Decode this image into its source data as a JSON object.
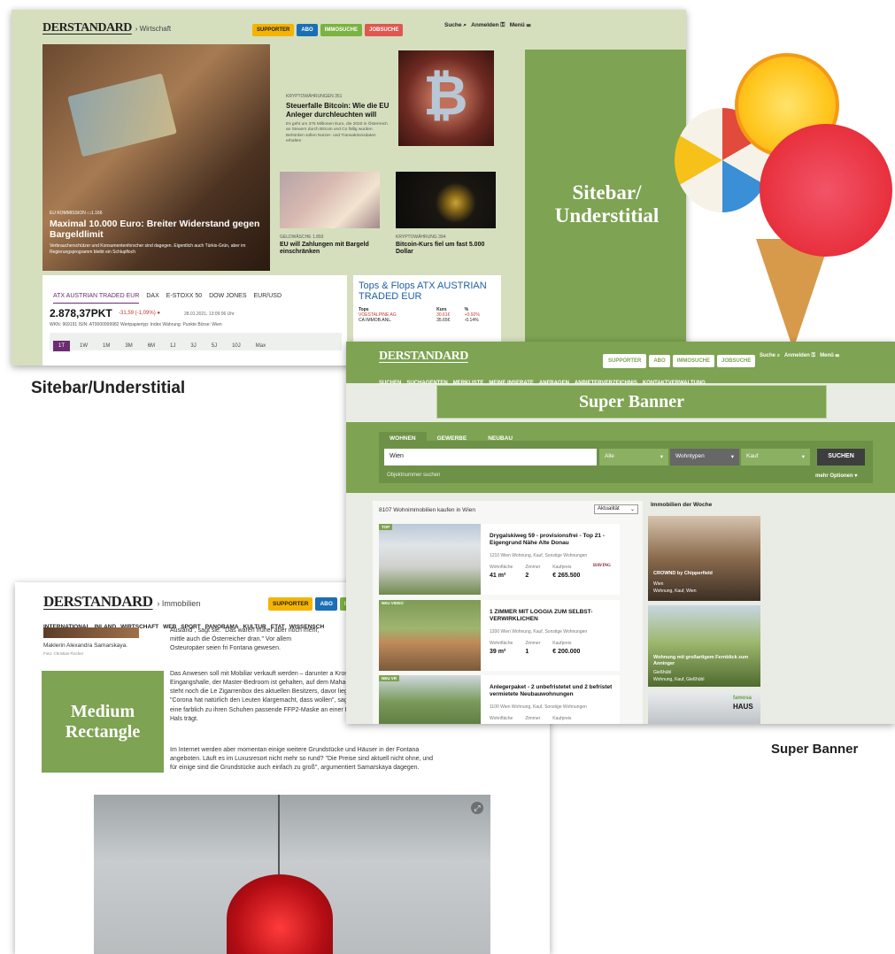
{
  "shot1": {
    "logo": "DERSTANDARD",
    "section": "› Wirtschaft",
    "buttons": {
      "supporter": "SUPPORTER",
      "abo": "ABO",
      "immosuche": "IMMOSUCHE",
      "jobsuche": "JOBSUCHE"
    },
    "search": "Suche",
    "login": "Anmelden",
    "menu": "Menü",
    "hero": {
      "kicker": "EU KOMMISSION",
      "count": "1.166",
      "title": "Maximal 10.000 Euro: Breiter Widerstand gegen Bargeldlimit",
      "teaser": "Verbraucherschützer und Konsumentenforscher sind dagegen. Eigentlich auch Türkis-Grün, aber im Regierungsprogramm bleibt ein Schlupfloch"
    },
    "art1": {
      "kicker": "KRYPTOWÄHRUNGEN",
      "count": "351",
      "title": "Steuerfalle Bitcoin: Wie die EU Anleger durchleuchten will",
      "teaser": "Es geht um 375 Millionen Euro, die 2020 in Österreich an Steuern durch Bitcoin und Co fällig wurden. Behörden sollen Nutzer- und Transaktionsdaten erhalten"
    },
    "art2": {
      "kicker": "GELDWÄSCHE",
      "count": "1.893",
      "title": "EU will Zahlungen mit Bargeld einschränken"
    },
    "art3": {
      "kicker": "KRYPTOWÄHRUNG",
      "count": "394",
      "title": "Bitcoin-Kurs fiel um fast 5.000 Dollar"
    },
    "market_tabs": [
      "ATX AUSTRIAN TRADED EUR",
      "DAX",
      "E-STOXX 50",
      "DOW JONES",
      "EUR/USD"
    ],
    "price": "2.878,37PKT",
    "change": "-31,59 (-1,09%)",
    "date": "28.01.2021, 13:09:06 Uhr",
    "meta": "WKN: 969191  ISIN: AT0000999982  Wertpapiertyp: Index  Währung: Punkte  Börse: Wien",
    "ranges": [
      "1T",
      "1W",
      "1M",
      "3M",
      "6M",
      "1J",
      "3J",
      "5J",
      "10J",
      "Max"
    ],
    "tops": {
      "title": "Tops & Flops ATX AUSTRIAN TRADED EUR",
      "h1": "Tops",
      "h2": "Kurs",
      "h3": "%",
      "r1": [
        "VOESTALPINE AG",
        "30.61€",
        "+0.92%"
      ],
      "r2": [
        "CA IMMOB.ANL.",
        "35.65€",
        "-0.14%"
      ]
    },
    "ad": "Sitebar/ Understitial",
    "caption": "Sitebar/Understitial"
  },
  "shot2": {
    "logo": "DERSTANDARD",
    "buttons": {
      "supporter": "SUPPORTER",
      "abo": "ABO",
      "immosuche": "IMMOSUCHE",
      "jobsuche": "JOBSUCHE"
    },
    "search": "Suche",
    "login": "Anmelden",
    "menu": "Menü",
    "nav": [
      "SUCHEN",
      "SUCHAGENTEN",
      "MERKLISTE",
      "MEINE INSERATE",
      "ANFRAGEN",
      "ANBIETERVERZEICHNIS",
      "KONTAKTVERWALTUNG"
    ],
    "ad": "Super Banner",
    "tabs": [
      "WOHNEN",
      "GEWERBE",
      "NEUBAU"
    ],
    "location": "Wien",
    "sel1": "Alle",
    "sel2": "Wohntypen",
    "sel3": "Kauf",
    "submit": "SUCHEN",
    "objekt": "Objektnummer suchen",
    "more": "mehr Optionen",
    "results": "8107 Wohnimmobilien kaufen in Wien",
    "sort": "Aktualität",
    "week": "Immobilien der Woche",
    "listings": [
      {
        "badge": "TOP",
        "title": "Drygalskiweg 59 - provisionsfrei - Top 21 - Eigengrund Nähe Alte Donau",
        "sub": "1210 Wien Wohnung, Kauf, Sonstige Wohnungen",
        "l1": "Wohnfläche",
        "l2": "Zimmer",
        "l3": "Kaufpreis",
        "v1": "41 m²",
        "v2": "2",
        "v3": "€ 265.500"
      },
      {
        "badge": "NEU",
        "badge2": "VIDEO",
        "title": "1 ZIMMER MIT LOGGIA ZUM SELBST-VERWIRKLICHEN",
        "sub": "1200 Wien Wohnung, Kauf, Sonstige Wohnungen",
        "l1": "Wohnfläche",
        "l2": "Zimmer",
        "l3": "Kaufpreis",
        "v1": "39 m²",
        "v2": "1",
        "v3": "€ 200.000"
      },
      {
        "badge": "NEU",
        "badge2": "VR",
        "title": "Anlegerpaket - 2 unbefristetet und 2 befristet vermietete Neubauwohnungen",
        "sub": "1100 Wien Wohnung, Kauf, Sonstige Wohnungen",
        "l1": "Wohnfläche",
        "l2": "Zimmer",
        "l3": "Kaufpreis"
      }
    ],
    "brand": "HAVING",
    "week1": {
      "title": "CROWND by Chipperfield",
      "sub1": "Wien",
      "sub2": "Wohnung, Kauf, Wien"
    },
    "week2": {
      "title": "Wohnung mit großartigem Fernblick zum Anninger",
      "sub1": "Gießhübl",
      "sub2": "Wohnung, Kauf, Gießhübl"
    },
    "week3": {
      "brand1": "famosa",
      "brand2": "HAUS"
    },
    "caption": "Super Banner"
  },
  "shot3": {
    "logo": "DERSTANDARD",
    "section": "› Immobilien",
    "buttons": {
      "supporter": "SUPPORTER",
      "abo": "ABO",
      "immo": "IM"
    },
    "nav": [
      "INTERNATIONAL",
      "INLAND",
      "WIRTSCHAFT",
      "WEB",
      "SPORT",
      "PANORAMA",
      "KULTUR",
      "ETAT",
      "WISSENSCH"
    ],
    "photo_caption": "Maklerin Alexandra Samarskaya.",
    "photo_credit": "Foto: Christian Fischer",
    "ad": "Medium Rectangle",
    "p1": "Ausland\", sagt sie. \"Das waren früher aber noch mehr, mittle auch die Österreicher dran.\" Vor allem Osteuropäer seien fri Fontana gewesen.",
    "p2": "Das Anwesen soll mit Mobiliar verkauft werden – darunter a Kronleuchter in der Eingangshalle, der Master-Bedroom ist gehalten, auf dem Mahagony-Schreibtisch steht noch die Le Zigarrenbox des aktuellen Besitzers, davor liegen Golfbälle Farben. \"Corona hat natürlich den Leuten klargemacht, dass wollen\", sagt Samarskaya, die eine farblich zu ihren Schuhen passende FFP2-Maske an einer Perlenkette um den Hals trägt.",
    "p3": "Im Internet werden aber momentan einige weitere Grundstücke und Häuser in der Fontana angeboten. Läuft es im Luxusresort nicht mehr so rund? \"Die Preise sind aktuell nicht ohne, und für einige sind die Grundstücke auch einfach zu groß\", argumentiert Samarskaya dagegen."
  },
  "caption_right": "Super Banner",
  "colors": {
    "green": "#7ea352",
    "supporter": "#f4b400",
    "abo": "#1a6fb5",
    "immo": "#7bb241",
    "job": "#e0574f",
    "neg": "#c0392b",
    "purple": "#6b2d72"
  }
}
